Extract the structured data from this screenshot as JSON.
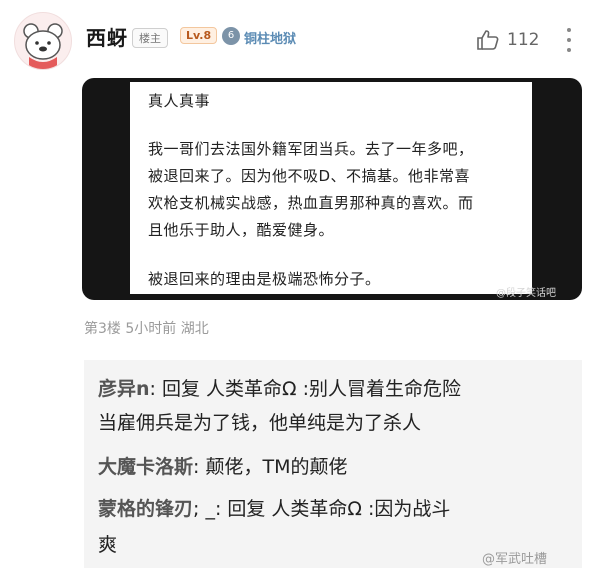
{
  "post": {
    "username": "西蚜",
    "tag_owner": "楼主",
    "level": "Lv.8",
    "badge_num": "6",
    "badge_text": "铜柱地狱",
    "like_count": "112",
    "meta": "第3楼  5小时前  湖北"
  },
  "image": {
    "lines": [
      "真人真事",
      "我一哥们去法国外籍军团当兵。去了一年多吧，",
      "被退回来了。因为他不吸D、不搞基。他非常喜",
      "欢枪支机械实战感，热血直男那种真的喜欢。而",
      "且他乐于助人，酷爱健身。",
      "被退回来的理由是极端恐怖分子。"
    ],
    "watermark": "@段子笑话吧"
  },
  "replies": [
    {
      "author": "彦异n",
      "line1": ": 回复 人类革命Ω :别人冒着生命危险",
      "line2": "当雇佣兵是为了钱，他单纯是为了杀人"
    },
    {
      "author": "大魔卡洛斯",
      "line1": ": 颠佬，TM的颠佬",
      "line2": ""
    },
    {
      "author": "蒙格的锋刃",
      "line1": "; _: 回复 人类革命Ω :因为战斗",
      "line2": "爽"
    }
  ],
  "footer_watermark": "@军武吐槽",
  "icons": [
    "avatar-bear",
    "thumbs-up-icon",
    "more-icon"
  ]
}
